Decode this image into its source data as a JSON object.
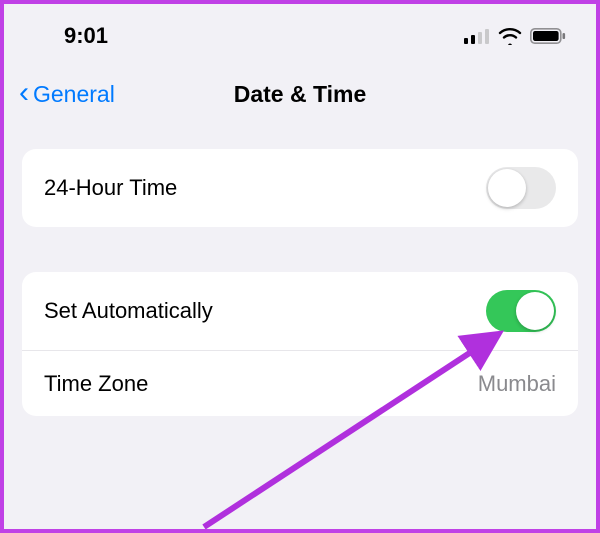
{
  "status": {
    "time": "9:01"
  },
  "nav": {
    "back_label": "General",
    "title": "Date & Time"
  },
  "group1": {
    "row1_label": "24-Hour Time",
    "row1_toggle": false
  },
  "group2": {
    "row1_label": "Set Automatically",
    "row1_toggle": true,
    "row2_label": "Time Zone",
    "row2_value": "Mumbai"
  }
}
